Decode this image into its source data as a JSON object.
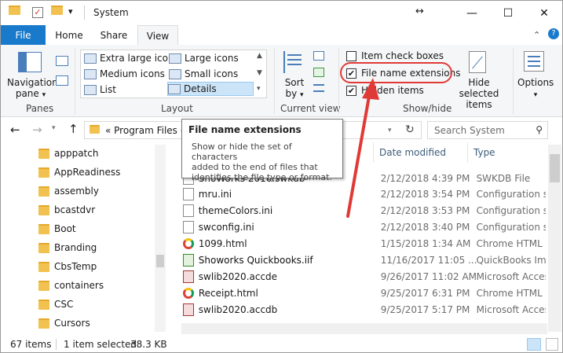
{
  "titlebar": {
    "title": "System",
    "minimize": "—",
    "maximize": "☐",
    "close": "✕",
    "qa_dropdown": "▾"
  },
  "tabs": {
    "file": "File",
    "home": "Home",
    "share": "Share",
    "view": "View"
  },
  "ribbon": {
    "panes": {
      "nav_pane_1": "Navigation",
      "nav_pane_2": "pane",
      "label": "Panes"
    },
    "layout": {
      "items": [
        "Extra large icons",
        "Large icons",
        "Medium icons",
        "Small icons",
        "List",
        "Details"
      ],
      "label": "Layout"
    },
    "current_view": {
      "sort_1": "Sort",
      "sort_2": "by",
      "label": "Current view"
    },
    "show_hide": {
      "item_check_boxes": "Item check boxes",
      "file_name_extensions": "File name extensions",
      "hidden_items": "Hidden items",
      "hide_selected_1": "Hide selected",
      "hide_selected_2": "items",
      "label": "Show/hide"
    },
    "options": "Options"
  },
  "nav": {
    "address": "« Program Files (",
    "search_placeholder": "Search System"
  },
  "tooltip": {
    "title": "File name extensions",
    "body_1": "Show or hide the set of characters",
    "body_2": "added to the end of files that",
    "body_3": "identifies the file type or format."
  },
  "tree": [
    "apppatch",
    "AppReadiness",
    "assembly",
    "bcastdvr",
    "Boot",
    "Branding",
    "CbsTemp",
    "containers",
    "CSC",
    "Cursors"
  ],
  "columns": {
    "date": "Date modified",
    "type": "Type"
  },
  "files": [
    {
      "name": "ShoWorks 2010.swkdb",
      "date": "2/12/2018 4:39 PM",
      "type": "SWKDB File"
    },
    {
      "name": "mru.ini",
      "date": "2/12/2018 3:54 PM",
      "type": "Configuration sett"
    },
    {
      "name": "themeColors.ini",
      "date": "2/12/2018 3:53 PM",
      "type": "Configuration sett"
    },
    {
      "name": "swconfig.ini",
      "date": "2/12/2018 3:40 PM",
      "type": "Configuration sett"
    },
    {
      "name": "1099.html",
      "date": "1/15/2018 1:34 AM",
      "type": "Chrome HTML Do"
    },
    {
      "name": "Showorks Quickbooks.iif",
      "date": "11/16/2017 11:05 ...",
      "type": "QuickBooks Impor"
    },
    {
      "name": "swlib2020.accde",
      "date": "9/26/2017 11:02 AM",
      "type": "Microsoft Access A"
    },
    {
      "name": "Receipt.html",
      "date": "9/25/2017 6:31 PM",
      "type": "Chrome HTML Do"
    },
    {
      "name": "swlib2020.accdb",
      "date": "9/25/2017 5:17 PM",
      "type": "Microsoft Access D"
    }
  ],
  "status": {
    "items": "67 items",
    "selected": "1 item selected",
    "size": "38.3 KB"
  },
  "colors": {
    "file_tab": "#1979ca",
    "annotation": "#e03a36",
    "folder": "#f1c24f"
  }
}
